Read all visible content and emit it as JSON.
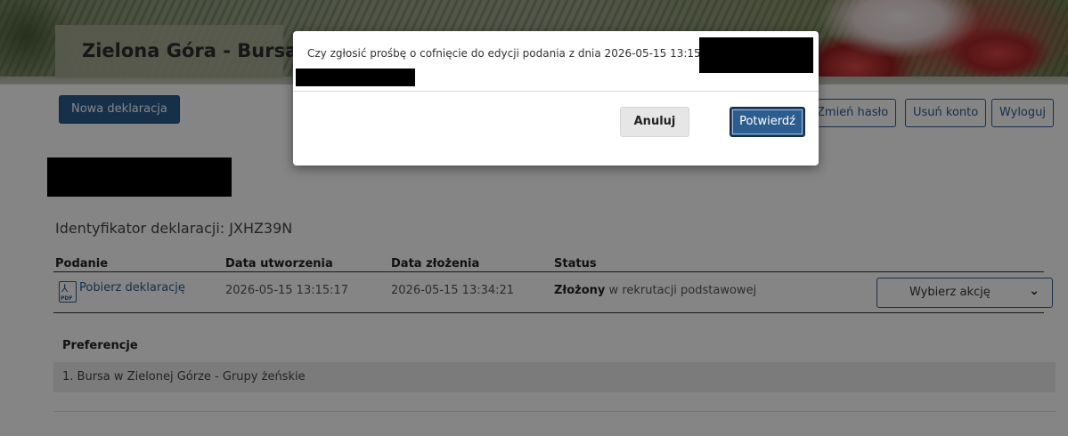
{
  "header": {
    "site_title": "Zielona Góra - Bursa"
  },
  "toolbar": {
    "new_declaration": "Nowa deklaracja",
    "change_password": "Zmień hasło",
    "delete_account": "Usuń konto",
    "logout": "Wyloguj"
  },
  "declaration": {
    "identifier_label": "Identyfikator deklaracji: JXHZ39N",
    "columns": [
      "Podanie",
      "Data utworzenia",
      "Data złożenia",
      "Status"
    ],
    "row": {
      "download_label": "Pobierz deklarację",
      "pdf_icon_text": "PDF",
      "created": "2026-05-15 13:15:17",
      "submitted": "2026-05-15 13:34:21",
      "status_bold": "Złożony",
      "status_rest": " w rekrutacji podstawowej",
      "action_select": "Wybierz akcję"
    },
    "preferences_heading": "Preferencje",
    "preferences": [
      "1.   Bursa w Zielonej Górze - Grupy żeńskie"
    ]
  },
  "modal": {
    "message": "Czy zgłosić prośbę o cofnięcie do edycji podania z dnia 2026-05-15 13:15:17",
    "cancel_label": "Anuluj",
    "confirm_label": "Potwierdź"
  },
  "colors": {
    "primary": "#2c5d8f",
    "overlay": "rgba(0,0,0,0.48)",
    "redaction": "#000000"
  },
  "icons": [
    "pdf-icon",
    "chevron-down-icon"
  ]
}
